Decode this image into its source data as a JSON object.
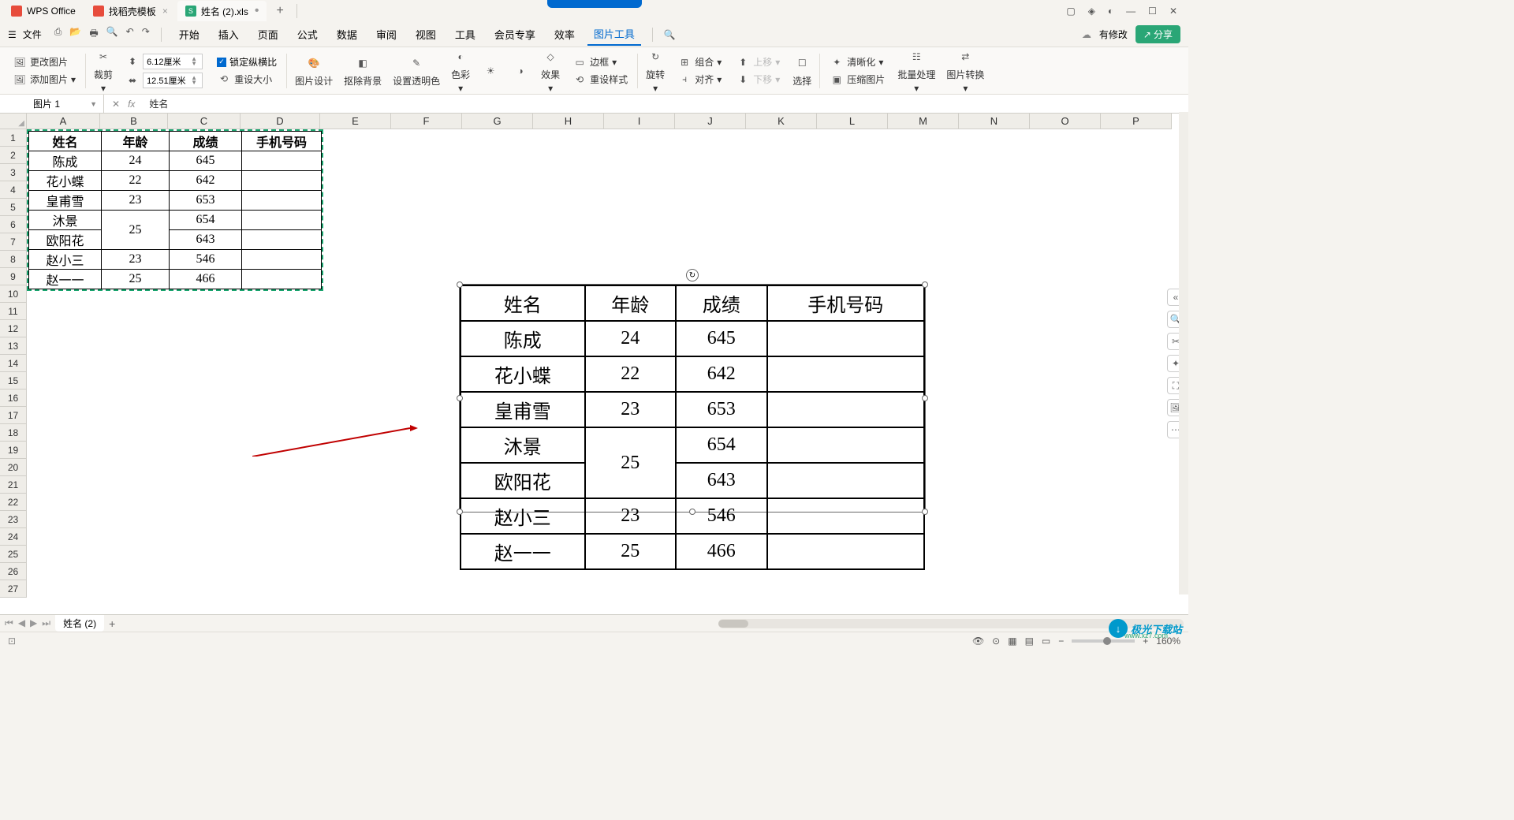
{
  "tabs": {
    "t1": "WPS Office",
    "t2": "找稻壳模板",
    "t3": "姓名 (2).xls"
  },
  "menu": {
    "file": "文件",
    "start": "开始",
    "insert": "插入",
    "page": "页面",
    "formula": "公式",
    "data": "数据",
    "review": "审阅",
    "view": "视图",
    "tools": "工具",
    "member": "会员专享",
    "efficiency": "效率",
    "pictools": "图片工具",
    "haschange": "有修改",
    "share": "分享"
  },
  "ribbon": {
    "changepic": "更改图片",
    "addpic": "添加图片",
    "crop": "裁剪",
    "h": "6.12厘米",
    "w": "12.51厘米",
    "lock": "锁定纵横比",
    "reset": "重设大小",
    "picdesign": "图片设计",
    "rmbg": "抠除背景",
    "trans": "设置透明色",
    "color": "色彩",
    "effect": "效果",
    "border": "边框",
    "resetstyle": "重设样式",
    "rotate": "旋转",
    "group": "组合",
    "align": "对齐",
    "up": "上移",
    "down": "下移",
    "select": "选择",
    "clarify": "清晰化",
    "compress": "压缩图片",
    "batch": "批量处理",
    "convert": "图片转换"
  },
  "formula": {
    "namebox": "图片 1",
    "value": "姓名"
  },
  "cols": {
    "a": "A",
    "b": "B",
    "c": "C",
    "d": "D",
    "e": "E",
    "f": "F",
    "g": "G",
    "h": "H",
    "i": "I",
    "j": "J",
    "k": "K",
    "l": "L",
    "m": "M",
    "n": "N",
    "o": "O",
    "p": "P"
  },
  "table": {
    "h1": "姓名",
    "h2": "年龄",
    "h3": "成绩",
    "h4": "手机号码",
    "r1c1": "陈成",
    "r1c2": "24",
    "r1c3": "645",
    "r2c1": "花小蝶",
    "r2c2": "22",
    "r2c3": "642",
    "r3c1": "皇甫雪",
    "r3c2": "23",
    "r3c3": "653",
    "r4c1": "沐景",
    "r45c2": "25",
    "r4c3": "654",
    "r5c1": "欧阳花",
    "r5c3": "643",
    "r6c1": "赵小三",
    "r6c2": "23",
    "r6c3": "546",
    "r7c1": "赵一一",
    "r7c2": "25",
    "r7c3": "466"
  },
  "sheet": {
    "name": "姓名 (2)"
  },
  "status": {
    "zoom": "160%"
  },
  "watermark": {
    "text": "极光下载站",
    "sub": "www.xz7.com"
  }
}
